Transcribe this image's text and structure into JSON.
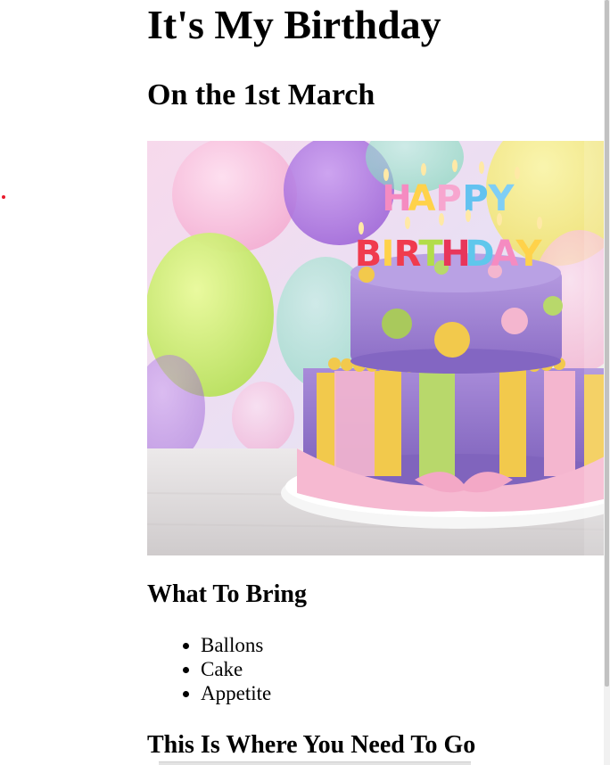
{
  "page": {
    "title": "It's My Birthday",
    "subtitle": "On the 1st March"
  },
  "image": {
    "alt": "Birthday cake with HAPPY BIRTHDAY candles",
    "cake_text_top": "HAPPY",
    "cake_text_bottom": "BIRTHDAY"
  },
  "bring": {
    "heading": "What To Bring",
    "items": [
      "Ballons",
      "Cake",
      "Appetite"
    ]
  },
  "directions": {
    "heading": "This Is Where You Need To Go"
  },
  "colors": {
    "accent_dot": "#e8192b",
    "cake_purple": "#9b7fd1",
    "cake_pink": "#f4b6cf",
    "cake_yellow": "#f2c94c",
    "cake_green": "#b8d86b"
  }
}
